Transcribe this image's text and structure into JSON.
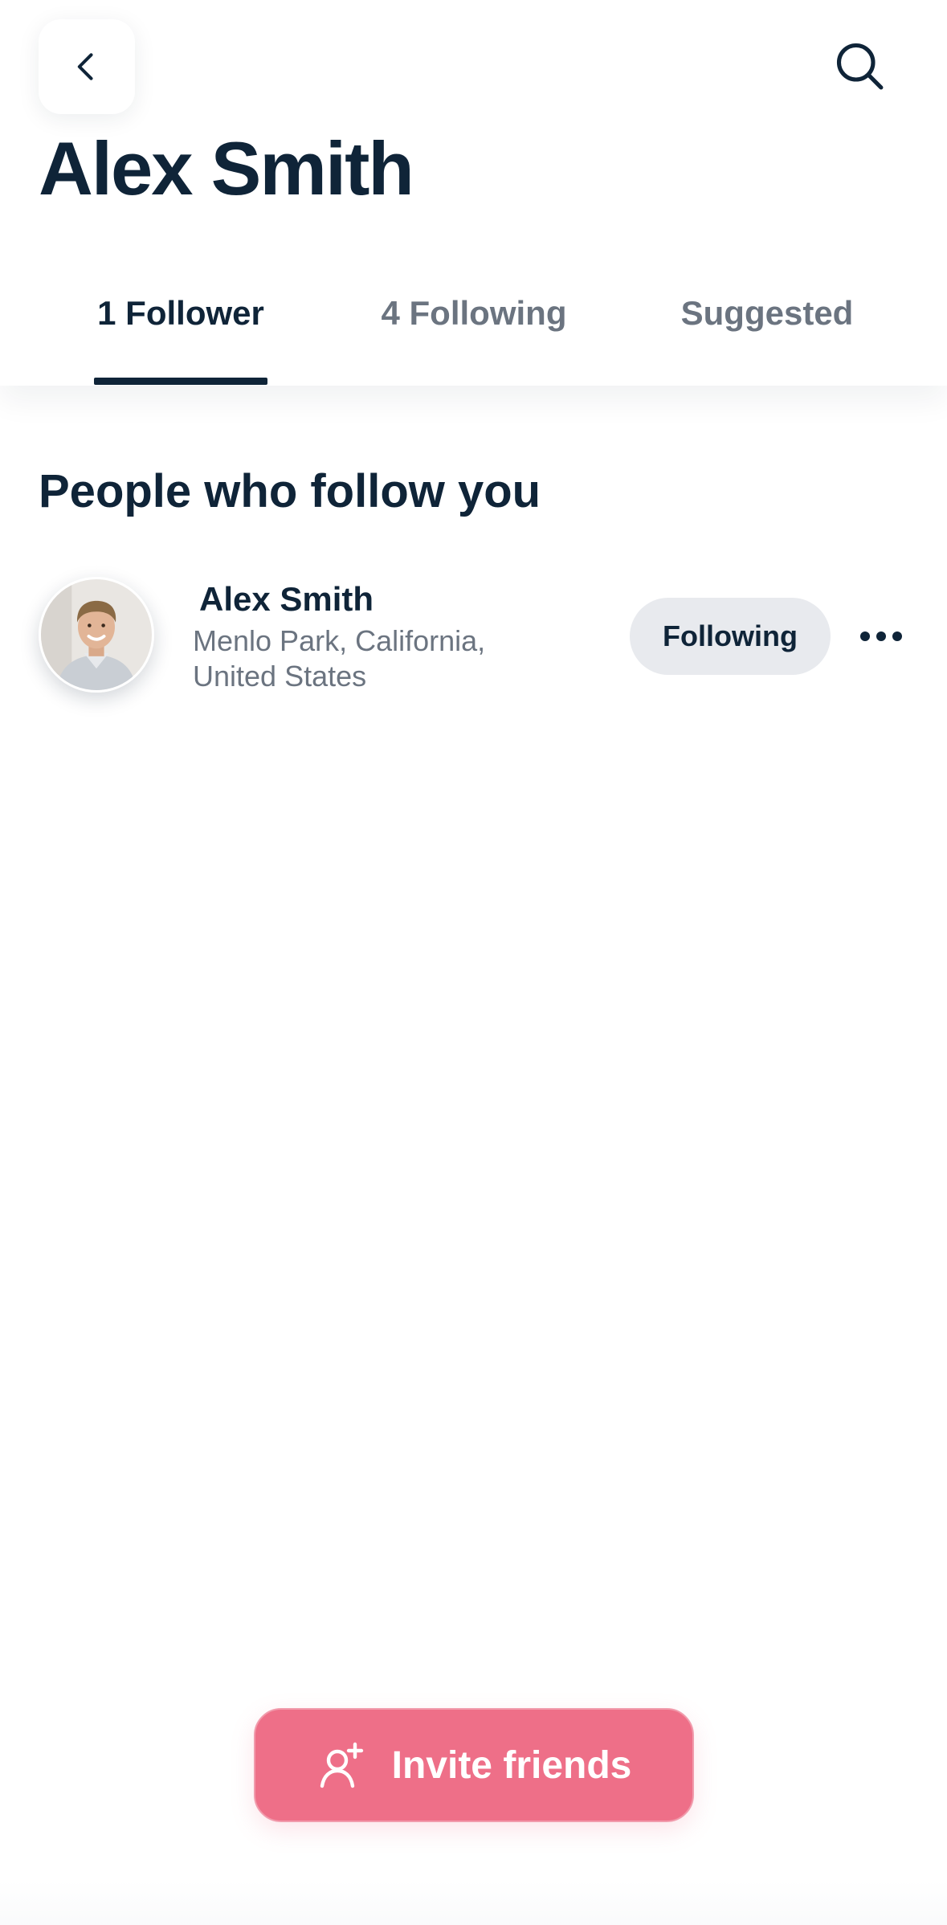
{
  "header": {
    "title": "Alex Smith",
    "back_icon": "chevron-left-icon",
    "search_icon": "search-icon"
  },
  "tabs": [
    {
      "label": "1 Follower",
      "active": true
    },
    {
      "label": "4 Following",
      "active": false
    },
    {
      "label": "Suggested",
      "active": false
    }
  ],
  "section": {
    "title": "People who follow you"
  },
  "followers": [
    {
      "name": "Alex Smith",
      "location": "Menlo Park, California, United States",
      "button_label": "Following",
      "more_icon": "more-horizontal-icon"
    }
  ],
  "invite": {
    "label": "Invite friends",
    "icon": "add-user-icon"
  },
  "colors": {
    "text_primary": "#0f2438",
    "text_secondary": "#6b7480",
    "accent": "#ee6f88",
    "chip_bg": "#e8eaee"
  }
}
